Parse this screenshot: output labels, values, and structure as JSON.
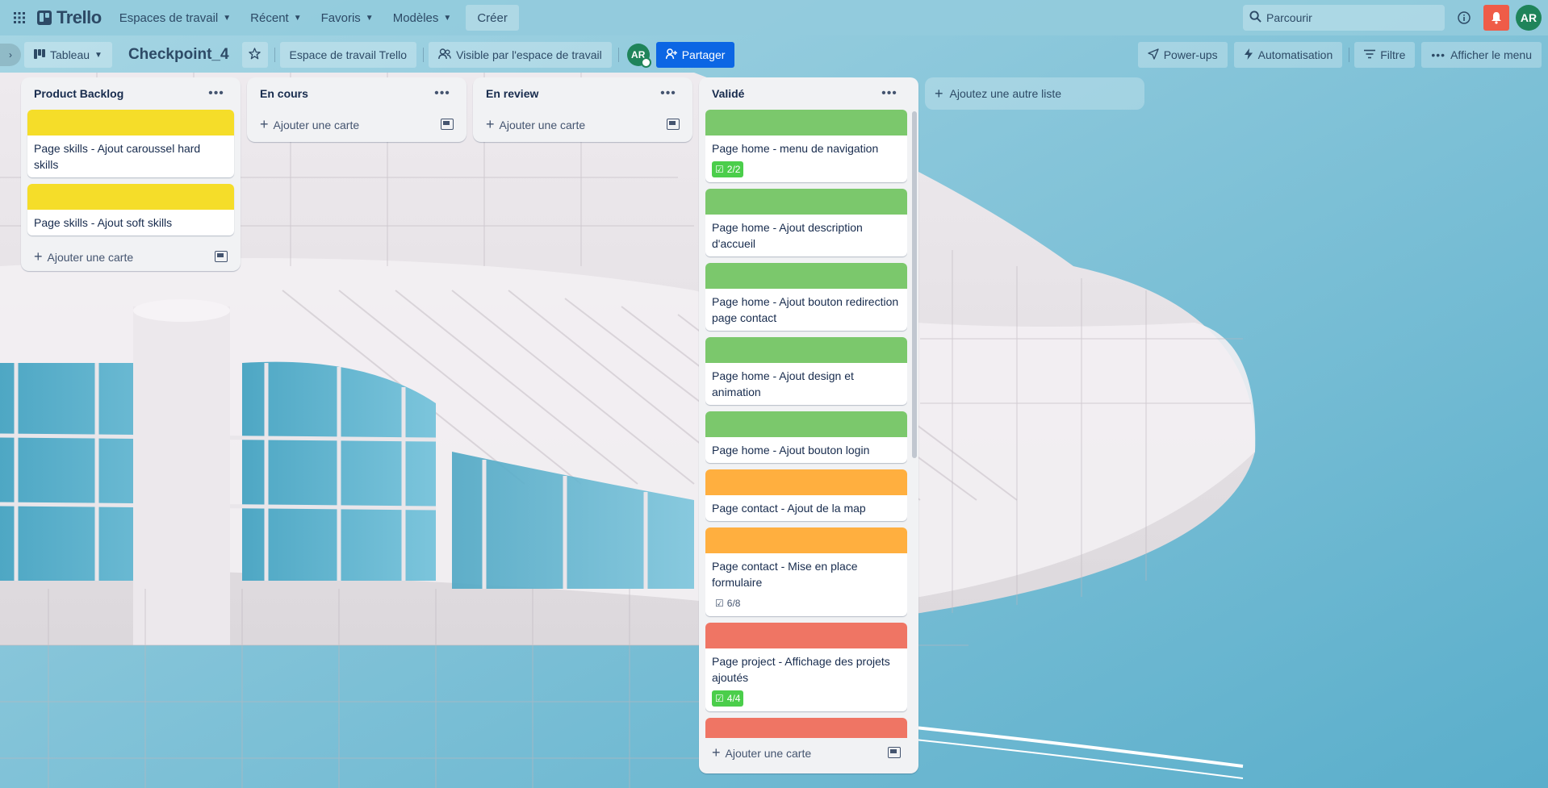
{
  "topnav": {
    "logo": "Trello",
    "menus": [
      {
        "label": "Espaces de travail"
      },
      {
        "label": "Récent"
      },
      {
        "label": "Favoris"
      },
      {
        "label": "Modèles"
      }
    ],
    "create_label": "Créer",
    "search_placeholder": "Parcourir",
    "avatar_initials": "AR"
  },
  "board": {
    "view_label": "Tableau",
    "title": "Checkpoint_4",
    "workspace_label": "Espace de travail Trello",
    "visibility_label": "Visible par l'espace de travail",
    "member_initials": "AR",
    "share_label": "Partager",
    "powerups_label": "Power-ups",
    "automation_label": "Automatisation",
    "filter_label": "Filtre",
    "menu_label": "Afficher le menu",
    "add_list_label": "Ajoutez une autre liste"
  },
  "lists": [
    {
      "title": "Product Backlog",
      "add_label": "Ajouter une carte",
      "cards": [
        {
          "title": "Page skills - Ajout caroussel hard skills",
          "cover": "#f5dd29"
        },
        {
          "title": "Page skills - Ajout soft skills",
          "cover": "#f5dd29"
        }
      ]
    },
    {
      "title": "En cours",
      "add_label": "Ajouter une carte",
      "cards": []
    },
    {
      "title": "En review",
      "add_label": "Ajouter une carte",
      "cards": []
    },
    {
      "title": "Validé",
      "add_label": "Ajouter une carte",
      "cards": [
        {
          "title": "Page home - menu de navigation",
          "cover": "#7bc86c",
          "checklist": "2/2",
          "complete": true
        },
        {
          "title": "Page home - Ajout description d'accueil",
          "cover": "#7bc86c"
        },
        {
          "title": "Page home - Ajout bouton redirection page contact",
          "cover": "#7bc86c"
        },
        {
          "title": "Page home - Ajout design et animation",
          "cover": "#7bc86c"
        },
        {
          "title": "Page home - Ajout bouton login",
          "cover": "#7bc86c"
        },
        {
          "title": "Page contact - Ajout de la map",
          "cover": "#ffaf3f"
        },
        {
          "title": "Page contact - Mise en place formulaire",
          "cover": "#ffaf3f",
          "checklist": "6/8",
          "complete": false
        },
        {
          "title": "Page project - Affichage des projets ajoutés",
          "cover": "#ef7564",
          "checklist": "4/4",
          "complete": true
        },
        {
          "title": "",
          "cover": "#ef7564"
        }
      ]
    }
  ]
}
